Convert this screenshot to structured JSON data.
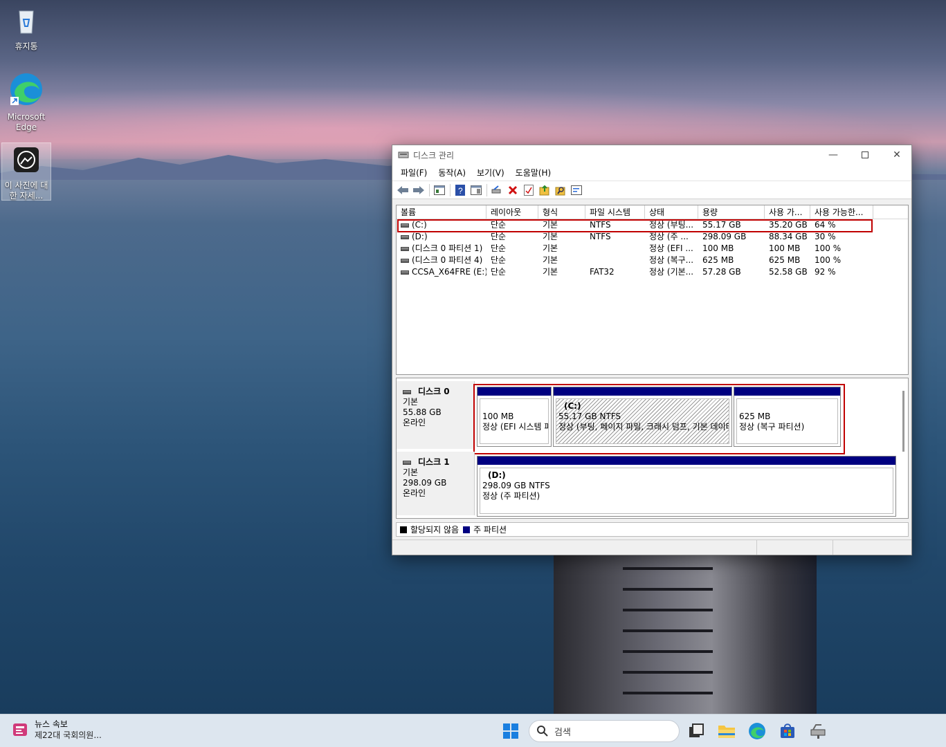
{
  "desktop": {
    "icons": [
      {
        "label": "휴지통",
        "icon": "recycle-bin-icon"
      },
      {
        "label": "Microsoft Edge",
        "icon": "edge-icon"
      },
      {
        "label": "이 사진에 대한 자세...",
        "icon": "photo-info-icon"
      }
    ]
  },
  "window": {
    "title": "디스크 관리",
    "menu": [
      "파일(F)",
      "동작(A)",
      "보기(V)",
      "도움말(H)"
    ],
    "volume_list": {
      "columns": [
        "볼륨",
        "레이아웃",
        "형식",
        "파일 시스템",
        "상태",
        "용량",
        "사용 가...",
        "사용 가능한..."
      ],
      "rows": [
        [
          "(C:)",
          "단순",
          "기본",
          "NTFS",
          "정상 (부팅...",
          "55.17 GB",
          "35.20 GB",
          "64 %"
        ],
        [
          "(D:)",
          "단순",
          "기본",
          "NTFS",
          "정상 (주 ...",
          "298.09 GB",
          "88.34 GB",
          "30 %"
        ],
        [
          "(디스크 0 파티션 1)",
          "단순",
          "기본",
          "",
          "정상 (EFI ...",
          "100 MB",
          "100 MB",
          "100 %"
        ],
        [
          "(디스크 0 파티션 4)",
          "단순",
          "기본",
          "",
          "정상 (복구...",
          "625 MB",
          "625 MB",
          "100 %"
        ],
        [
          "CCSA_X64FRE (E:)",
          "단순",
          "기본",
          "FAT32",
          "정상 (기본...",
          "57.28 GB",
          "52.58 GB",
          "92 %"
        ]
      ]
    },
    "disks": [
      {
        "name": "디스크 0",
        "type": "기본",
        "size": "55.88 GB",
        "status": "온라인",
        "partitions": [
          {
            "title": "",
            "size": "100 MB",
            "status": "정상 (EFI 시스템 파티션)"
          },
          {
            "title": "(C:)",
            "size": "55.17 GB NTFS",
            "status": "정상 (부팅, 페이지 파일, 크래시 덤프, 기본 데이터 파티션)"
          },
          {
            "title": "",
            "size": "625 MB",
            "status": "정상 (복구 파티션)"
          }
        ]
      },
      {
        "name": "디스크 1",
        "type": "기본",
        "size": "298.09 GB",
        "status": "온라인",
        "partitions": [
          {
            "title": "(D:)",
            "size": "298.09 GB NTFS",
            "status": "정상 (주 파티션)"
          }
        ]
      }
    ],
    "legend": {
      "unallocated": "할당되지 않음",
      "primary": "주 파티션"
    },
    "colors": {
      "primary": "#000080",
      "unallocated": "#000000",
      "highlight": "#c00000"
    }
  },
  "taskbar": {
    "news_title": "뉴스 속보",
    "news_text": "제22대 국회의원...",
    "search_placeholder": "검색"
  }
}
